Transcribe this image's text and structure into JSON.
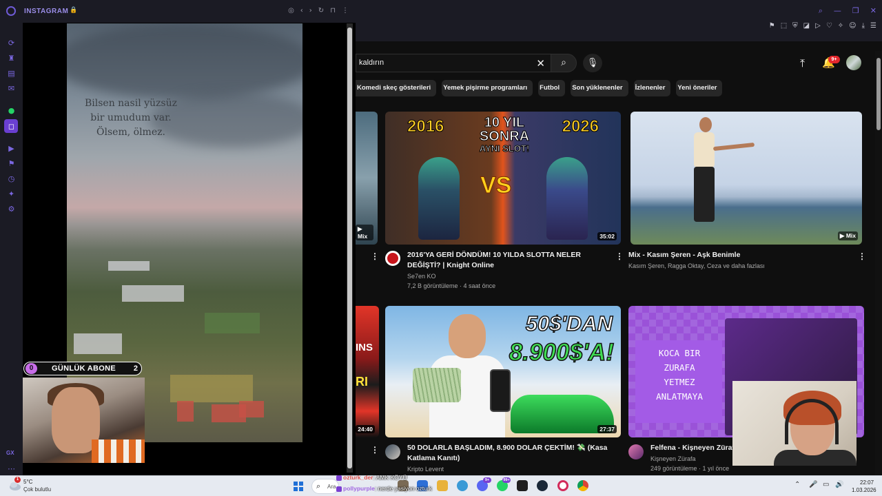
{
  "instagram_panel": {
    "title": "INSTAGRAM",
    "caption_lines": [
      "Bilsen nasil yüzsüz",
      "bir umudum var.",
      "Ölsem, ölmez."
    ]
  },
  "abone_widget": {
    "left_value": "0",
    "label": "GÜNLÜK ABONE",
    "right_value": "2"
  },
  "youtube": {
    "search_value": "kaldırın",
    "notification_badge": "9+",
    "chips": [
      "Komedi skeç gösterileri",
      "Yemek pişirme programları",
      "Futbol",
      "Son yüklenenler",
      "İzlenenler",
      "Yeni öneriler"
    ],
    "partial_cards": [
      {
        "badge": "Mix"
      },
      {
        "duration": "24:40",
        "thumb_lines": [
          "INS",
          "RI"
        ]
      }
    ],
    "videos": [
      {
        "thumb_year_left": "2016",
        "thumb_year_right": "2026",
        "thumb_mid_line1": "10 YIL",
        "thumb_mid_line2": "SONRA",
        "thumb_mid_line3": "AYNI SLOT!",
        "thumb_vs": "VS",
        "duration": "35:02",
        "title": "2016'YA GERİ DÖNDÜM! 10 YILDA SLOTTA NELER DEĞİŞTİ? | Knight Online",
        "channel": "Se7en KO",
        "stats": "7,2 B görüntüleme · 4 saat önce"
      },
      {
        "badge": "Mix",
        "title": "Mix - Kasım Şeren - Aşk Benimle",
        "channel": "Kasım Şeren, Ragga Oktay, Ceza ve daha fazlası"
      },
      {
        "thumb_line1": "50$'DAN",
        "thumb_line2": "8.900$'A!",
        "duration": "27:37",
        "title": "50 DOLARLA BAŞLADIM, 8.900 DOLAR ÇEKTİM! 💸 (Kasa Katlama Kanıtı)",
        "channel": "Kripto Levent"
      },
      {
        "thumb_lines": [
          "KOCA BIR",
          "ZURAFA",
          "YETMEZ",
          "ANLATMAYA"
        ],
        "title": "Felfena - Kişneyen Zürafa",
        "channel": "Kişneyen Zürafa",
        "stats": "249 görüntüleme · 1 yıl önce"
      }
    ]
  },
  "chat_overlay": [
    {
      "user": "ozturk_der",
      "message": ": AMK KÖYÜ"
    },
    {
      "user": "pollypurple",
      "message": ": nerde yasiyon ozturk"
    }
  ],
  "taskbar": {
    "weather_badge": "1",
    "temperature": "5°C",
    "weather_desc": "Çok bulutlu",
    "search_placeholder": "Ara",
    "app_badge_1": "9+",
    "app_badge_2": "99+",
    "time": "22:07",
    "date": "1.03.2026"
  },
  "colors": {
    "opera_accent": "#7a67e0",
    "youtube_bg": "#0f0f0f",
    "notification_red": "#e4282e",
    "taskbar_bg": "#e6eaf1"
  }
}
